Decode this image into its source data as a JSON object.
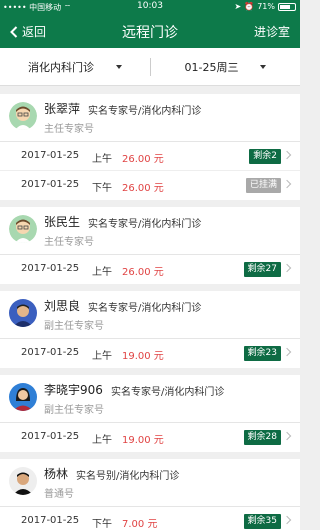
{
  "status_bar": {
    "carrier": "中国移动",
    "network": "⁠",
    "time": "10:03",
    "battery": "71%",
    "battery_level": 0.71,
    "colors": {
      "bg": "#0d7a4a"
    }
  },
  "nav": {
    "back_label": "返回",
    "title": "远程门诊",
    "right_label": "进诊室"
  },
  "filters": {
    "department": "消化内科门诊",
    "date": "01-25周三"
  },
  "colors": {
    "accent": "#0d7a4a",
    "price": "#e04343",
    "badge": "#0e6b44",
    "badge_full": "#a9a9a9"
  },
  "doctors": [
    {
      "name": "张翠萍",
      "type": "实名专家号/消化内科门诊",
      "title": "主任专家号",
      "avatar": "cartoon-doctor-icon",
      "slots": [
        {
          "date": "2017-01-25",
          "period": "上午",
          "price": "26.00 元",
          "status": "剩余2",
          "full": false
        },
        {
          "date": "2017-01-25",
          "period": "下午",
          "price": "26.00 元",
          "status": "已挂满",
          "full": true
        }
      ]
    },
    {
      "name": "张民生",
      "type": "实名专家号/消化内科门诊",
      "title": "主任专家号",
      "avatar": "cartoon-doctor-icon",
      "slots": [
        {
          "date": "2017-01-25",
          "period": "上午",
          "price": "26.00 元",
          "status": "剩余27",
          "full": false
        }
      ]
    },
    {
      "name": "刘思良",
      "type": "实名专家号/消化内科门诊",
      "title": "副主任专家号",
      "avatar": "photo-male-avatar",
      "slots": [
        {
          "date": "2017-01-25",
          "period": "上午",
          "price": "19.00 元",
          "status": "剩余23",
          "full": false
        }
      ]
    },
    {
      "name": "李晓宇906",
      "type": "实名专家号/消化内科门诊",
      "title": "副主任专家号",
      "avatar": "photo-female-avatar",
      "slots": [
        {
          "date": "2017-01-25",
          "period": "上午",
          "price": "19.00 元",
          "status": "剩余28",
          "full": false
        }
      ]
    },
    {
      "name": "杨林",
      "type": "实名号别/消化内科门诊",
      "title": "普通号",
      "avatar": "photo-male-avatar-2",
      "slots": [
        {
          "date": "2017-01-25",
          "period": "下午",
          "price": "7.00 元",
          "status": "剩余35",
          "full": false
        }
      ]
    }
  ]
}
